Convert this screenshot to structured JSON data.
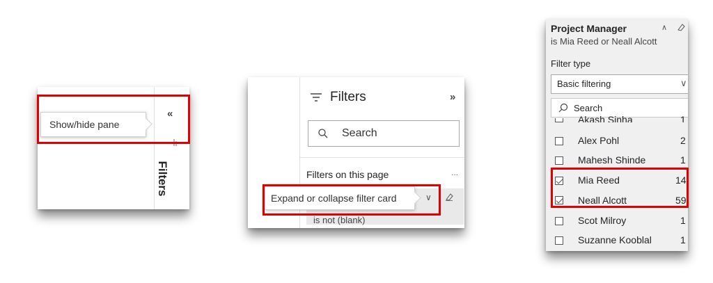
{
  "panel1": {
    "tooltip": "Show/hide pane",
    "pane_title": "Filters"
  },
  "panel2": {
    "title": "Filters",
    "search_placeholder": "Search",
    "section_label": "Filters on this page",
    "more_label": "...",
    "tooltip": "Expand or collapse filter card",
    "card_subtitle": "is not (blank)"
  },
  "panel3": {
    "card_title": "Project Manager",
    "card_subtitle": "is Mia Reed or Neall Alcott",
    "filter_type_label": "Filter type",
    "filter_type_value": "Basic filtering",
    "search_placeholder": "Search",
    "items": [
      {
        "label": "Akash Sinha",
        "count": "1",
        "checked": false
      },
      {
        "label": "Alex Pohl",
        "count": "2",
        "checked": false
      },
      {
        "label": "Mahesh Shinde",
        "count": "1",
        "checked": false
      },
      {
        "label": "Mia Reed",
        "count": "14",
        "checked": true
      },
      {
        "label": "Neall Alcott",
        "count": "59",
        "checked": true
      },
      {
        "label": "Scot Milroy",
        "count": "1",
        "checked": false
      },
      {
        "label": "Suzanne Kooblal",
        "count": "1",
        "checked": false
      }
    ]
  },
  "colors": {
    "highlight": "#e00000",
    "panel_gray": "#f0f0f0",
    "card_gray": "#e9e9e9"
  }
}
